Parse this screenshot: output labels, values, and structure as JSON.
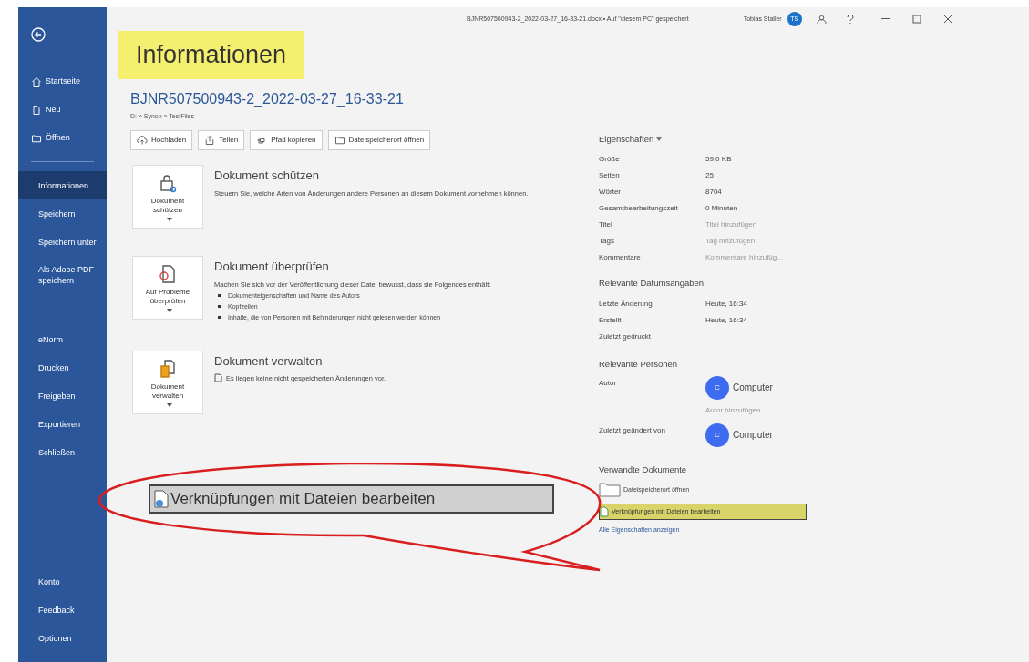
{
  "window": {
    "title": "BJNR507500943-2_2022-03-27_16-33-21.docx • Auf \"diesem PC\" gespeichert",
    "user": "Tobias Staller",
    "avatar": "TS"
  },
  "sidebar": {
    "top": [
      {
        "label": "Startseite"
      },
      {
        "label": "Neu"
      },
      {
        "label": "Öffnen"
      }
    ],
    "items": [
      {
        "label": "Informationen",
        "selected": true
      },
      {
        "label": "Speichern",
        "selected": false
      },
      {
        "label": "Speichern unter",
        "selected": false
      },
      {
        "label": "Als Adobe PDF speichern",
        "selected": false
      },
      {
        "label": "eNorm",
        "selected": false
      },
      {
        "label": "Drucken",
        "selected": false
      },
      {
        "label": "Freigeben",
        "selected": false
      },
      {
        "label": "Exportieren",
        "selected": false
      },
      {
        "label": "Schließen",
        "selected": false
      }
    ],
    "bottom": [
      {
        "label": "Konto"
      },
      {
        "label": "Feedback"
      },
      {
        "label": "Optionen"
      }
    ]
  },
  "page": {
    "title": "Informationen",
    "title_highlighted": true,
    "doc_name": "BJNR507500943-2_2022-03-27_16-33-21",
    "path": "D: » Synop » TestFiles",
    "actions": [
      {
        "label": "Hochladen"
      },
      {
        "label": "Teilen"
      },
      {
        "label": "Pfad kopieren"
      },
      {
        "label": "Dateispeicherort öffnen"
      }
    ]
  },
  "sections": [
    {
      "button": "Dokument schützen",
      "heading": "Dokument schützen",
      "text": "Steuern Sie, welche Arten von Änderungen andere Personen an diesem Dokument vornehmen können."
    },
    {
      "button": "Auf Probleme überprüfen",
      "heading": "Dokument überprüfen",
      "text": "Machen Sie sich vor der Veröffentlichung dieser Datei bewusst, dass sie Folgendes enthält:",
      "bullets": [
        "Dokumenteigenschaften und Name des Autors",
        "Kopfzeilen",
        "Inhalte, die von Personen mit Behinderungen nicht gelesen werden können"
      ]
    },
    {
      "button": "Dokument verwalten",
      "heading": "Dokument verwalten",
      "text": "Es liegen keine nicht gespeicherten Änderungen vor."
    }
  ],
  "properties": {
    "heading": "Eigenschaften",
    "rows": [
      {
        "label": "Größe",
        "value": "59,0 KB",
        "muted": false
      },
      {
        "label": "Seiten",
        "value": "25",
        "muted": false
      },
      {
        "label": "Wörter",
        "value": "8704",
        "muted": false
      },
      {
        "label": "Gesamtbearbeitungszeit",
        "value": "0 Minuten",
        "muted": false
      },
      {
        "label": "Titel",
        "value": "Titel hinzufügen",
        "muted": true
      },
      {
        "label": "Tags",
        "value": "Tag hinzufügen",
        "muted": true
      },
      {
        "label": "Kommentare",
        "value": "Kommentare hinzufüg...",
        "muted": true
      }
    ]
  },
  "dates": {
    "heading": "Relevante Datumsangaben",
    "rows": [
      {
        "label": "Letzte Änderung",
        "value": "Heute, 16:34"
      },
      {
        "label": "Erstellt",
        "value": "Heute, 16:34"
      },
      {
        "label": "Zuletzt gedruckt"
      }
    ]
  },
  "people": {
    "heading": "Relevante Personen",
    "rows": [
      {
        "label": "Autor",
        "name": "Computer",
        "initial": "C",
        "add": "Autor hinzufügen"
      },
      {
        "label": "Zuletzt geändert von",
        "name": "Computer",
        "initial": "C"
      }
    ]
  },
  "related": {
    "heading": "Verwandte Dokumente",
    "links": [
      {
        "label": "Dateispeicherort öffnen",
        "kind": "folder",
        "highlighted": false
      },
      {
        "label": "Verknüpfungen mit Dateien bearbeiten",
        "kind": "file",
        "highlighted": true
      }
    ],
    "all": "Alle Eigenschaften anzeigen"
  },
  "callout": {
    "text": "Verknüpfungen mit Dateien bearbeiten"
  }
}
